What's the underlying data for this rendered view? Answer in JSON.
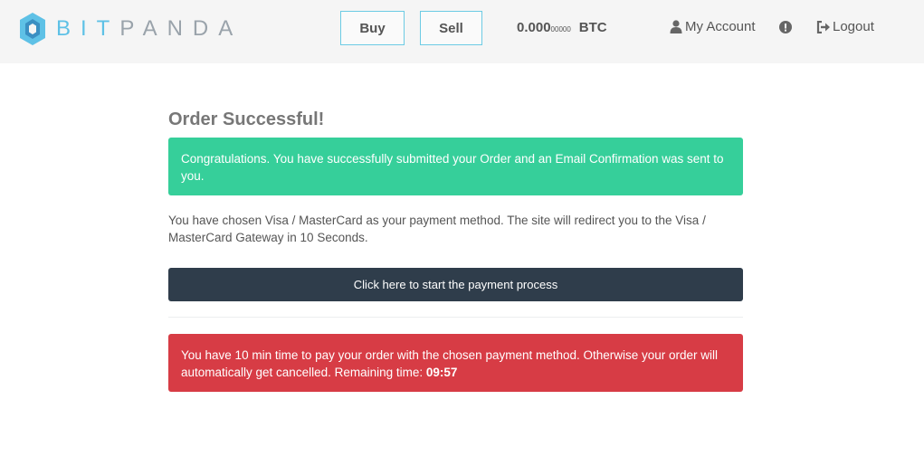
{
  "header": {
    "brand": {
      "part1": "BIT",
      "part2": "PANDA"
    },
    "buy_label": "Buy",
    "sell_label": "Sell",
    "balance": {
      "value": "0.000",
      "small_digits": "00000",
      "currency": "BTC"
    },
    "account_label": "My Account",
    "logout_label": "Logout"
  },
  "main": {
    "title": "Order Successful!",
    "success_message": "Congratulations. You have successfully submitted your Order and an Email Confirmation was sent to you.",
    "info_text": "You have chosen Visa / MasterCard as your payment method. The site will redirect you to the Visa / MasterCard Gateway in 10 Seconds.",
    "payment_button_label": "Click here to start the payment process",
    "warning_text": "You have 10 min time to pay your order with the chosen payment method. Otherwise your order will automatically get cancelled. Remaining time:",
    "remaining_time": "09:57"
  },
  "colors": {
    "success": "#36cf9a",
    "danger": "#d73c45",
    "dark_button": "#2f3d4b",
    "brand_blue": "#5ec1e6"
  },
  "icons": [
    "bitpanda-logo-icon",
    "user-icon",
    "exclamation-circle-icon",
    "logout-icon"
  ]
}
